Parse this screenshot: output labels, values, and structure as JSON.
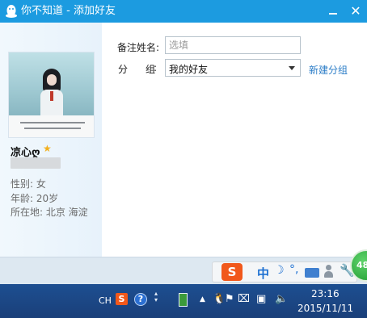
{
  "window": {
    "title": "你不知道 - 添加好友",
    "minimize_label": "",
    "close_label": "✕"
  },
  "profile": {
    "nickname": "凉心ღ",
    "star": "★",
    "gender": "性别: 女",
    "age": "年龄: 20岁",
    "location": "所在地: 北京  海淀"
  },
  "form": {
    "remark_label": "备注姓名:",
    "remark_placeholder": "选填",
    "remark_value": "",
    "group_label_a": "分",
    "group_label_b": "组",
    "group_colon": ":",
    "group_selected": "我的好友",
    "new_group_link": "新建分组"
  },
  "ime": {
    "logo": "S",
    "mode": "中",
    "moon": "☽",
    "punct": "°,",
    "wrench": "🔧",
    "badge": "48"
  },
  "taskbar": {
    "lang": "CH",
    "sogou": "S",
    "help": "?",
    "up_arrow": "▲",
    "time": "23:16",
    "date": "2015/11/11"
  },
  "colors": {
    "titlebar": "#1c9be0",
    "link": "#2a7cc7",
    "taskbar": "#1d4f91",
    "ime_accent": "#f1581b"
  }
}
